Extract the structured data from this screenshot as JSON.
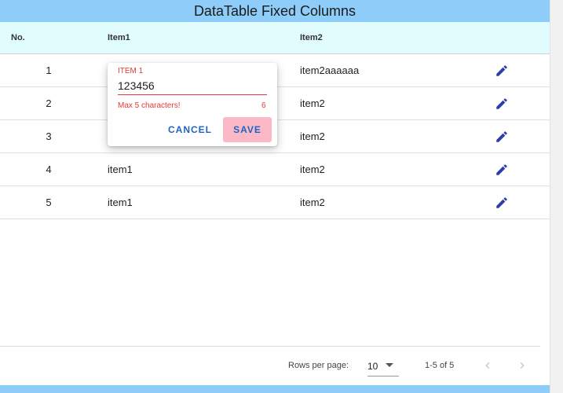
{
  "title": "DataTable Fixed Columns",
  "columns": [
    "No.",
    "Item1",
    "Item2"
  ],
  "rows": [
    {
      "no": "1",
      "item1": "",
      "item2": "item2aaaaaa"
    },
    {
      "no": "2",
      "item1": "",
      "item2": "item2"
    },
    {
      "no": "3",
      "item1": "",
      "item2": "item2"
    },
    {
      "no": "4",
      "item1": "item1",
      "item2": "item2"
    },
    {
      "no": "5",
      "item1": "item1",
      "item2": "item2"
    }
  ],
  "edit_icon": "pencil-icon",
  "popup": {
    "label": "ITEM 1",
    "value": "123456",
    "hint": "Max 5 characters!",
    "counter": "6",
    "cancel_label": "CANCEL",
    "save_label": "SAVE"
  },
  "footer": {
    "rows_per_page_label": "Rows per page:",
    "rows_per_page_value": "10",
    "range": "1-5 of 5"
  },
  "colors": {
    "header_bar": "#8ecdf9",
    "header_row": "#e1fcfd",
    "edit_icon": "#2d3ea8",
    "error": "#e53935",
    "button_text": "#1e63c4",
    "save_button_bg": "#fbb9c7"
  }
}
